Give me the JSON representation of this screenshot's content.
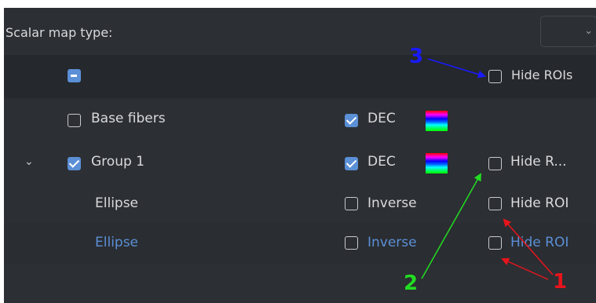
{
  "header": {
    "scalar_map_label": "Scalar map type:",
    "dropdown_value": ""
  },
  "table_header": {
    "hide_rois_label": "Hide ROIs"
  },
  "rows": [
    {
      "name": "Base fibers",
      "color_label": "DEC"
    },
    {
      "name": "Group 1",
      "color_label": "DEC",
      "hide_label": "Hide R..."
    },
    {
      "name": "Ellipse",
      "color_label": "Inverse",
      "hide_label": "Hide ROI"
    },
    {
      "name": "Ellipse",
      "color_label": "Inverse",
      "hide_label": "Hide ROI"
    }
  ],
  "annotations": {
    "one": "1",
    "two": "2",
    "three": "3",
    "color_red": "#e8141c",
    "color_green": "#22dd22",
    "color_blue": "#1a1aff"
  },
  "colors": {
    "panel_bg": "#2c2f33",
    "accent": "#5b8fd6",
    "text": "#d8dadc"
  }
}
